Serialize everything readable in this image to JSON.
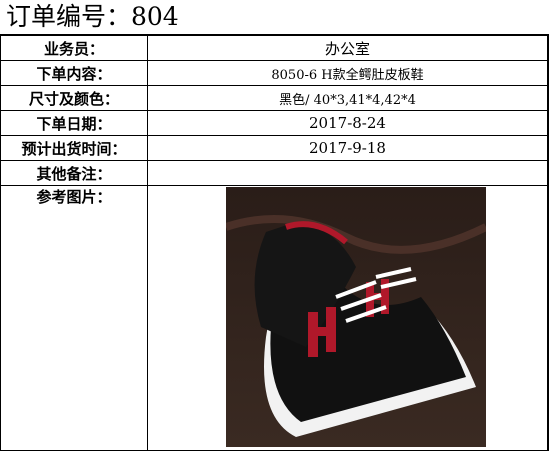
{
  "title": "订单编号：804",
  "rows": [
    {
      "label": "业务员：",
      "value": "办公室"
    },
    {
      "label": "下单内容：",
      "value": "8050-6 H款全鳄肚皮板鞋"
    },
    {
      "label": "尺寸及颜色：",
      "value": "黑色/ 40*3,41*4,42*4"
    },
    {
      "label": "下单日期：",
      "value": "2017-8-24"
    },
    {
      "label": "预计出货时间：",
      "value": "2017-9-18"
    },
    {
      "label": "其他备注：",
      "value": ""
    },
    {
      "label": "参考图片：",
      "value": ""
    }
  ],
  "colors": {
    "shoe_accent": "#b0182a"
  }
}
